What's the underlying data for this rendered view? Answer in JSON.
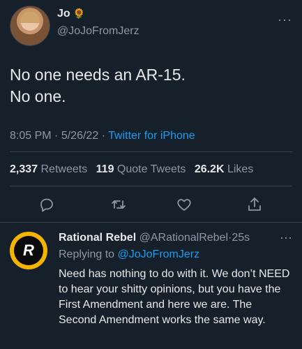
{
  "tweet": {
    "author_name": "Jo",
    "author_emoji": "🌻",
    "handle": "@JoJoFromJerz",
    "more": "···",
    "text": "No one needs an AR-15.\nNo one.",
    "time": "8:05 PM",
    "date": "5/26/22",
    "source": "Twitter for iPhone",
    "separator": "·"
  },
  "stats": {
    "retweets_count": "2,337",
    "retweets_label": "Retweets",
    "quotes_count": "119",
    "quotes_label": "Quote Tweets",
    "likes_count": "26.2K",
    "likes_label": "Likes"
  },
  "actions": [
    {
      "icon": "reply-icon"
    },
    {
      "icon": "retweet-icon"
    },
    {
      "icon": "like-icon"
    },
    {
      "icon": "share-icon"
    }
  ],
  "reply": {
    "name": "Rational Rebel",
    "handle": "@ARationalRebel",
    "separator": "·",
    "time": "25s",
    "more": "···",
    "replying_prefix": "Replying to",
    "replying_to": "@JoJoFromJerz",
    "text": "Need has nothing to do with it. We don’t NEED to hear your shitty opinions, but you have the First Amendment and here we are. The Second Amendment works the same way.",
    "avatar_initials": "R"
  },
  "colors": {
    "background": "#15202b",
    "accent": "#1d9bf0",
    "secondary_text": "#8b98a5",
    "reply_avatar_ring": "#f4b400"
  }
}
